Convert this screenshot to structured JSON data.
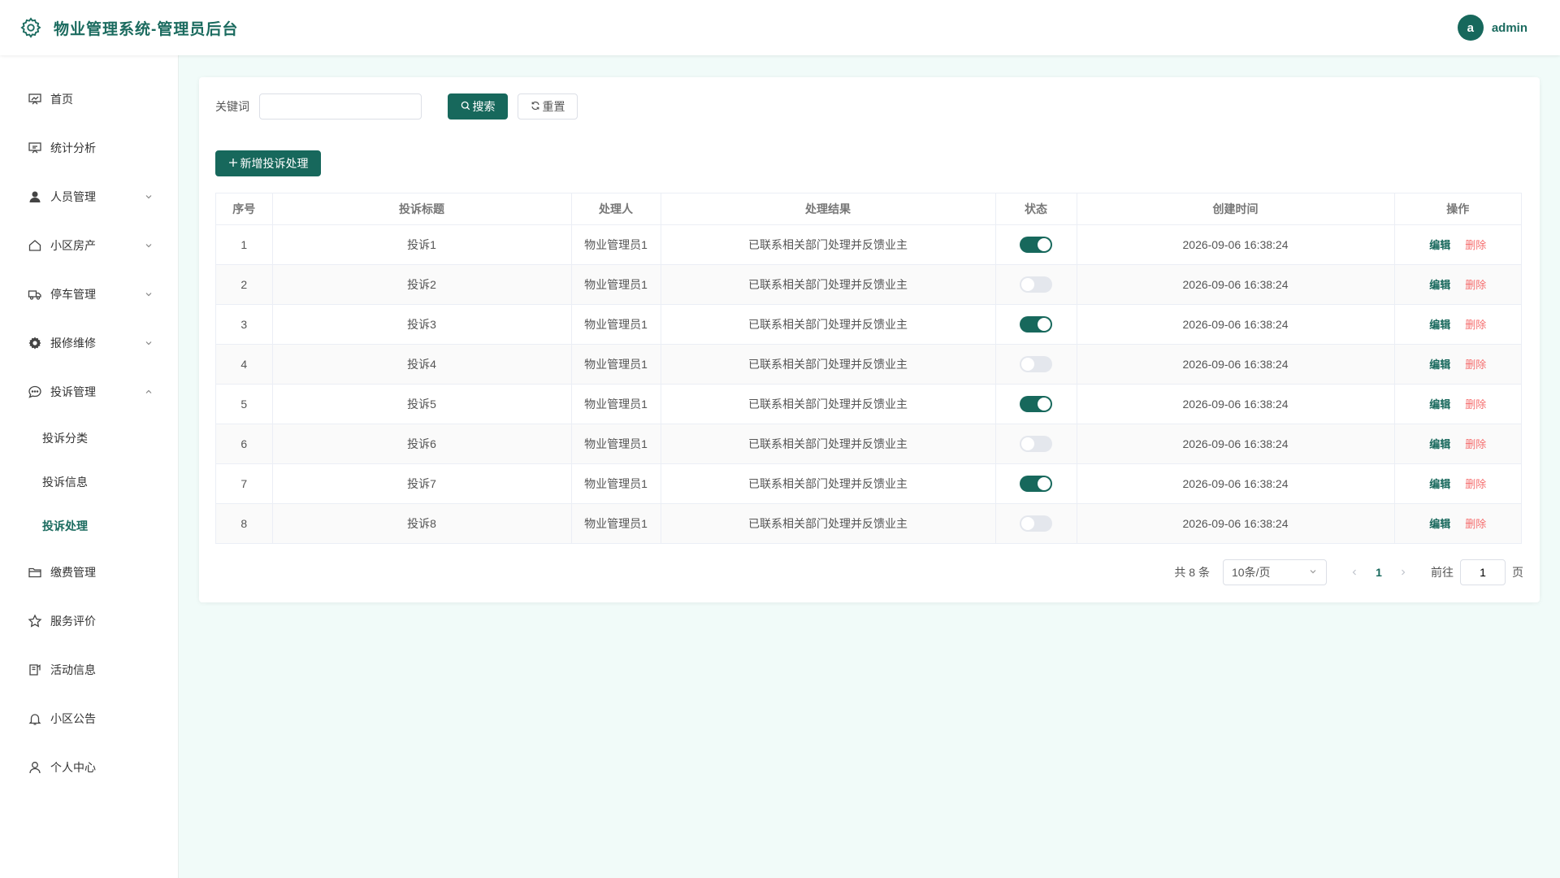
{
  "header": {
    "title": "物业管理系统-管理员后台",
    "avatar_letter": "a",
    "username": "admin"
  },
  "colors": {
    "primary": "#17685c",
    "danger": "#f56c6c",
    "background": "#f1fbf9"
  },
  "sidebar": {
    "items": [
      {
        "label": "首页",
        "icon": "chart-board-icon"
      },
      {
        "label": "统计分析",
        "icon": "presentation-icon"
      },
      {
        "label": "人员管理",
        "icon": "user-icon",
        "expandable": true
      },
      {
        "label": "小区房产",
        "icon": "house-icon",
        "expandable": true
      },
      {
        "label": "停车管理",
        "icon": "truck-icon",
        "expandable": true
      },
      {
        "label": "报修维修",
        "icon": "gear-icon",
        "expandable": true
      },
      {
        "label": "投诉管理",
        "icon": "chat-bubble-icon",
        "expandable": true,
        "expanded": true
      },
      {
        "label": "缴费管理",
        "icon": "folder-icon"
      },
      {
        "label": "服务评价",
        "icon": "star-icon"
      },
      {
        "label": "活动信息",
        "icon": "notebook-icon"
      },
      {
        "label": "小区公告",
        "icon": "bell-icon"
      },
      {
        "label": "个人中心",
        "icon": "user-outline-icon"
      }
    ],
    "sub_items": [
      {
        "label": "投诉分类",
        "active": false
      },
      {
        "label": "投诉信息",
        "active": false
      },
      {
        "label": "投诉处理",
        "active": true
      }
    ]
  },
  "search": {
    "label": "关键词",
    "value": "",
    "placeholder": "",
    "search_button": "搜索",
    "reset_button": "重置"
  },
  "add_button": "新增投诉处理",
  "table": {
    "columns": [
      "序号",
      "投诉标题",
      "处理人",
      "处理结果",
      "状态",
      "创建时间",
      "操作"
    ],
    "rows": [
      {
        "index": "1",
        "title": "投诉1",
        "handler": "物业管理员1",
        "result": "已联系相关部门处理并反馈业主",
        "status": true,
        "created": "2026-09-06 16:38:24"
      },
      {
        "index": "2",
        "title": "投诉2",
        "handler": "物业管理员1",
        "result": "已联系相关部门处理并反馈业主",
        "status": false,
        "created": "2026-09-06 16:38:24"
      },
      {
        "index": "3",
        "title": "投诉3",
        "handler": "物业管理员1",
        "result": "已联系相关部门处理并反馈业主",
        "status": true,
        "created": "2026-09-06 16:38:24"
      },
      {
        "index": "4",
        "title": "投诉4",
        "handler": "物业管理员1",
        "result": "已联系相关部门处理并反馈业主",
        "status": false,
        "created": "2026-09-06 16:38:24"
      },
      {
        "index": "5",
        "title": "投诉5",
        "handler": "物业管理员1",
        "result": "已联系相关部门处理并反馈业主",
        "status": true,
        "created": "2026-09-06 16:38:24"
      },
      {
        "index": "6",
        "title": "投诉6",
        "handler": "物业管理员1",
        "result": "已联系相关部门处理并反馈业主",
        "status": false,
        "created": "2026-09-06 16:38:24"
      },
      {
        "index": "7",
        "title": "投诉7",
        "handler": "物业管理员1",
        "result": "已联系相关部门处理并反馈业主",
        "status": true,
        "created": "2026-09-06 16:38:24"
      },
      {
        "index": "8",
        "title": "投诉8",
        "handler": "物业管理员1",
        "result": "已联系相关部门处理并反馈业主",
        "status": false,
        "created": "2026-09-06 16:38:24"
      }
    ],
    "edit_label": "编辑",
    "delete_label": "删除"
  },
  "pagination": {
    "total": "共 8 条",
    "page_size": "10条/页",
    "current_page": "1",
    "goto_label": "前往",
    "goto_value": "1",
    "page_suffix": "页"
  }
}
